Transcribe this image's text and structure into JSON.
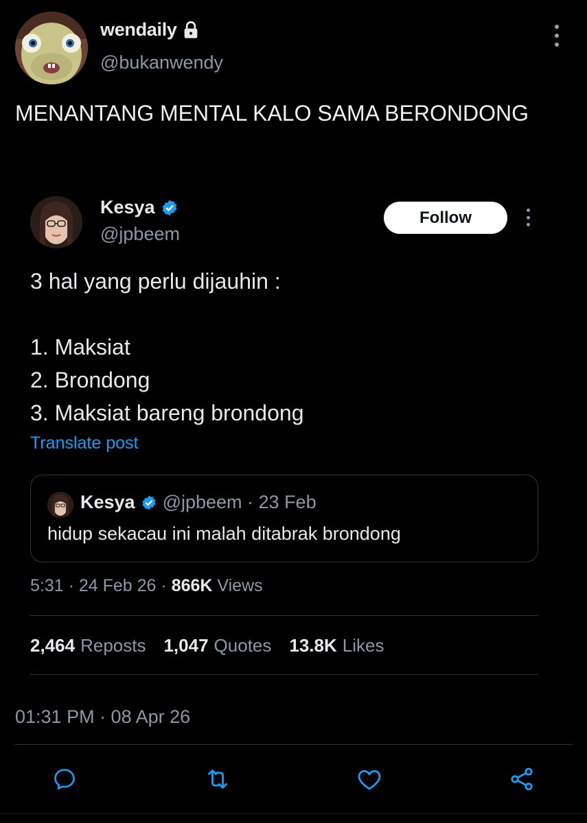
{
  "author": {
    "display_name": "wendaily",
    "handle": "@bukanwendy",
    "text": "MENANTANG MENTAL KALO SAMA BERONDONG",
    "timestamp": "01:31 PM · 08 Apr 26"
  },
  "quoted": {
    "display_name": "Kesya",
    "handle": "@jpbeem",
    "follow_label": "Follow",
    "lines": [
      "3 hal yang perlu dijauhin :",
      "",
      "1. Maksiat",
      "2. Brondong",
      "3. Maksiat bareng brondong"
    ],
    "translate_label": "Translate post",
    "nested": {
      "display_name": "Kesya",
      "handle_date": "@jpbeem · 23 Feb",
      "text": "hidup sekacau ini malah ditabrak brondong"
    },
    "meta": {
      "time_date": "5:31 · 24 Feb 26 · ",
      "views_count": "866K",
      "views_label": " Views"
    },
    "stats": {
      "reposts_count": "2,464",
      "reposts_label": "Reposts",
      "quotes_count": "1,047",
      "quotes_label": "Quotes",
      "likes_count": "13.8K",
      "likes_label": "Likes"
    }
  },
  "actions": [
    "reply-icon",
    "repost-icon",
    "like-icon",
    "share-icon"
  ],
  "colors": {
    "background": "#000000",
    "link": "#1d9bf0",
    "verified": "#1d9bf0",
    "muted": "#8b98a5"
  }
}
